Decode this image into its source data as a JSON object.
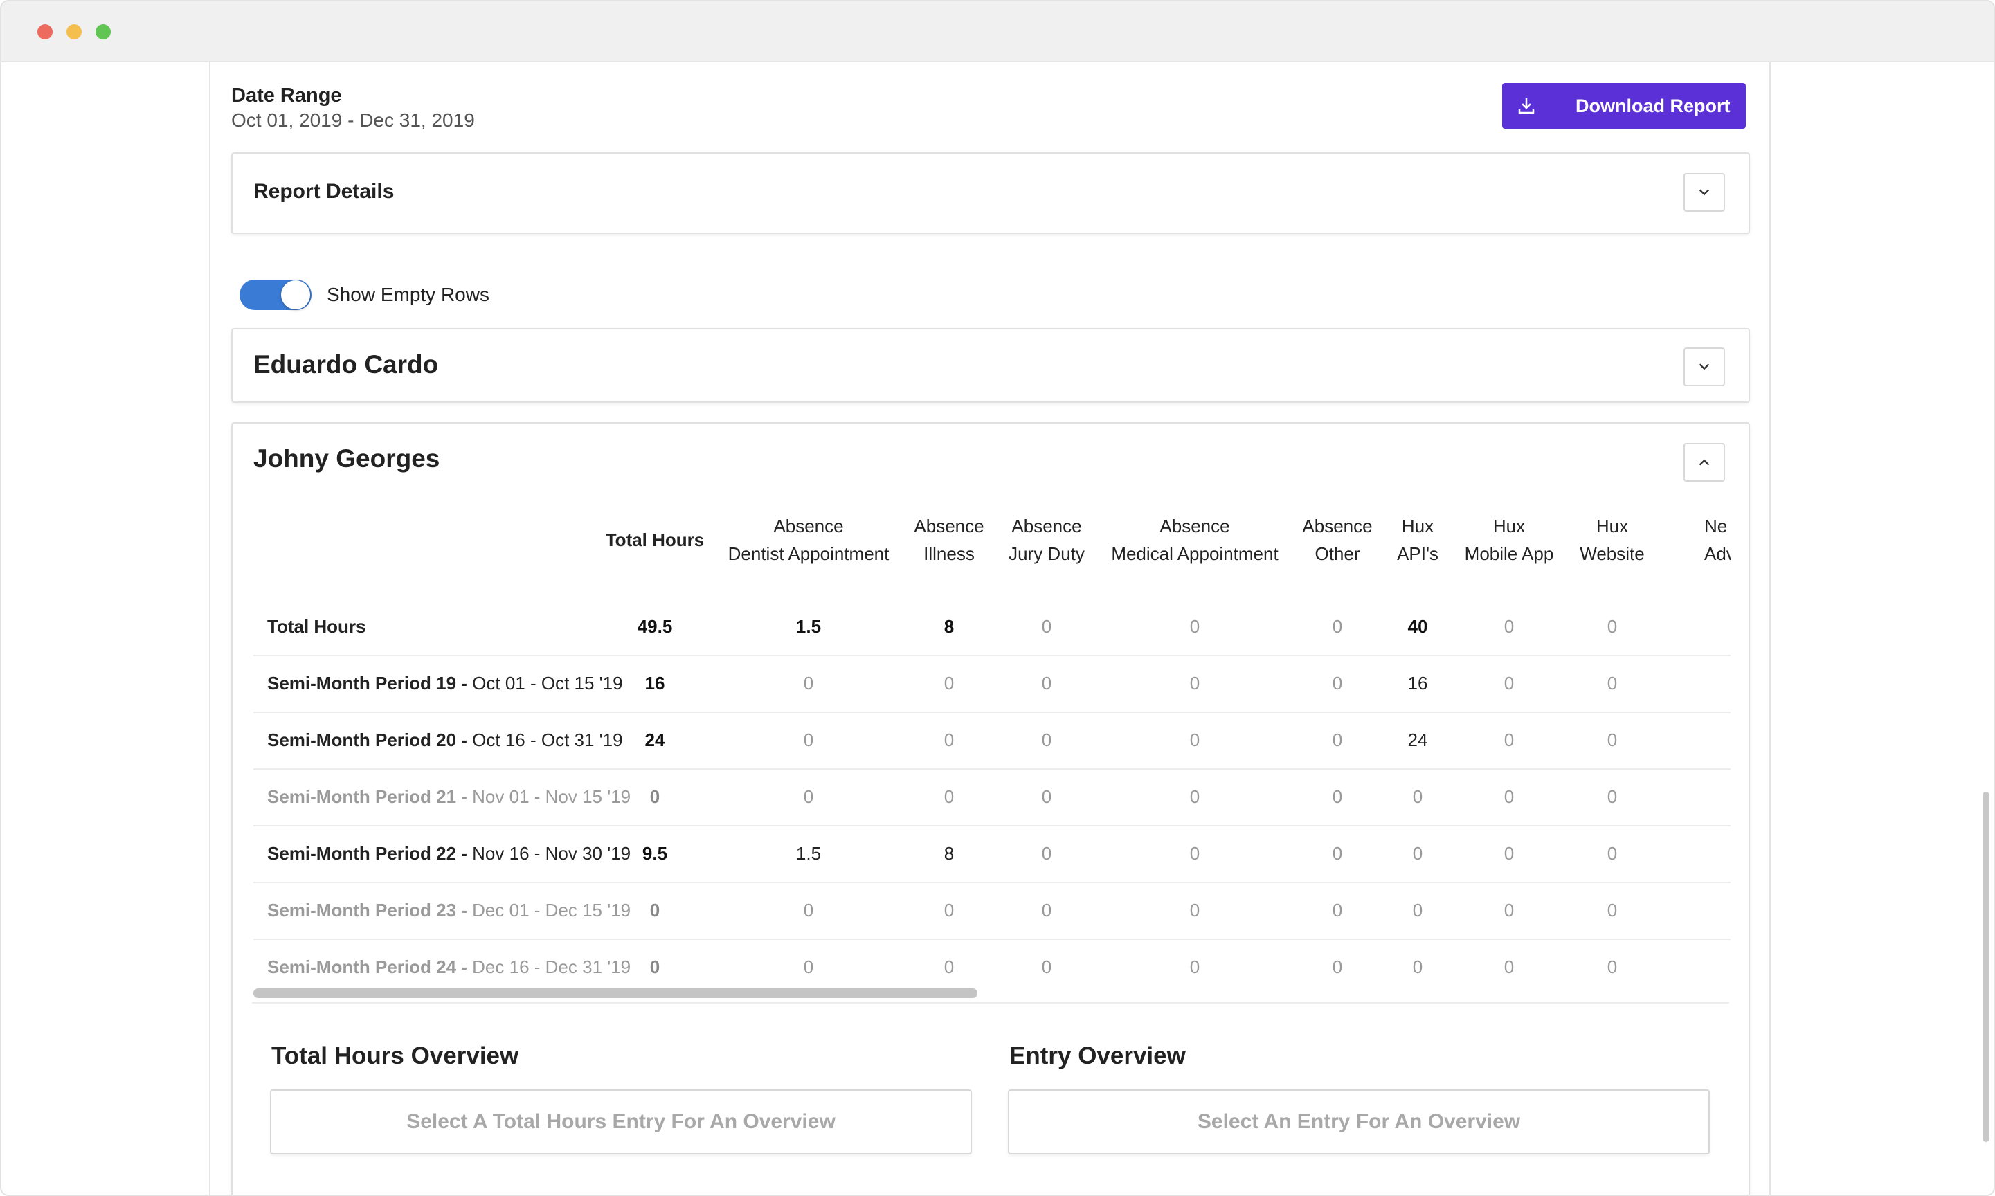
{
  "date_range": {
    "label": "Date Range",
    "value": "Oct 01, 2019 - Dec 31, 2019"
  },
  "download": {
    "label": "Download Report",
    "icon": "download-icon",
    "color": "#5b30d6"
  },
  "report_details": {
    "title": "Report Details"
  },
  "show_empty_rows": {
    "label": "Show Empty Rows",
    "on": true
  },
  "employees": [
    {
      "name": "Eduardo Cardo",
      "expanded": false
    },
    {
      "name": "Johny Georges",
      "expanded": true
    }
  ],
  "table": {
    "columns": [
      {
        "line1": "",
        "line2": "Total Hours"
      },
      {
        "line1": "Absence",
        "line2": "Dentist Appointment"
      },
      {
        "line1": "Absence",
        "line2": "Illness"
      },
      {
        "line1": "Absence",
        "line2": "Jury Duty"
      },
      {
        "line1": "Absence",
        "line2": "Medical Appointment"
      },
      {
        "line1": "Absence",
        "line2": "Other"
      },
      {
        "line1": "Hux",
        "line2": "API's"
      },
      {
        "line1": "Hux",
        "line2": "Mobile App"
      },
      {
        "line1": "Hux",
        "line2": "Website"
      },
      {
        "line1": "Ne",
        "line2": "Adve"
      }
    ],
    "rows": [
      {
        "label": "Total Hours",
        "range": "",
        "values": [
          "49.5",
          "1.5",
          "8",
          "0",
          "0",
          "0",
          "40",
          "0",
          "0"
        ]
      },
      {
        "label": "Semi-Month Period 19 -",
        "range": "Oct 01 - Oct 15 '19",
        "values": [
          "16",
          "0",
          "0",
          "0",
          "0",
          "0",
          "16",
          "0",
          "0"
        ]
      },
      {
        "label": "Semi-Month Period 20 -",
        "range": "Oct 16 - Oct 31 '19",
        "values": [
          "24",
          "0",
          "0",
          "0",
          "0",
          "0",
          "24",
          "0",
          "0"
        ]
      },
      {
        "label": "Semi-Month Period 21 -",
        "range": "Nov 01 - Nov 15 '19",
        "values": [
          "0",
          "0",
          "0",
          "0",
          "0",
          "0",
          "0",
          "0",
          "0"
        ]
      },
      {
        "label": "Semi-Month Period 22 -",
        "range": "Nov 16 - Nov 30 '19",
        "values": [
          "9.5",
          "1.5",
          "8",
          "0",
          "0",
          "0",
          "0",
          "0",
          "0"
        ]
      },
      {
        "label": "Semi-Month Period 23 -",
        "range": "Dec 01 - Dec 15 '19",
        "values": [
          "0",
          "0",
          "0",
          "0",
          "0",
          "0",
          "0",
          "0",
          "0"
        ]
      },
      {
        "label": "Semi-Month Period 24 -",
        "range": "Dec 16 - Dec 31 '19",
        "values": [
          "0",
          "0",
          "0",
          "0",
          "0",
          "0",
          "0",
          "0",
          "0"
        ]
      }
    ]
  },
  "total_hours_overview": {
    "title": "Total Hours Overview",
    "placeholder": "Select A Total Hours Entry For An Overview"
  },
  "entry_overview": {
    "title": "Entry Overview",
    "placeholder": "Select An Entry For An Overview"
  }
}
